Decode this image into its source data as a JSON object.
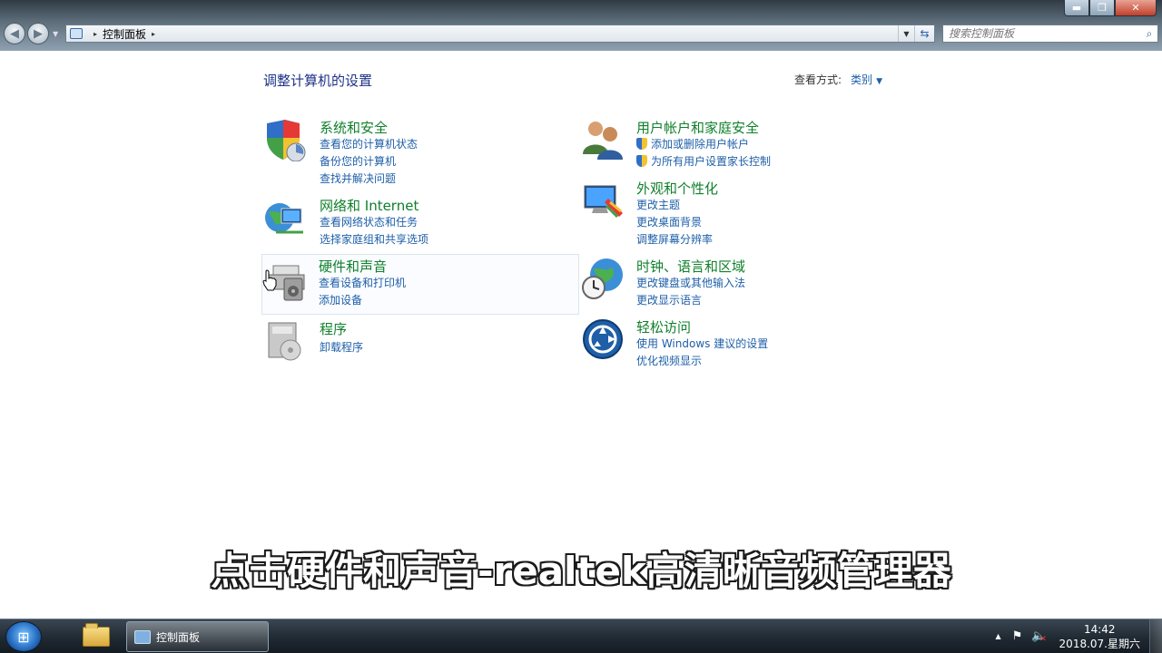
{
  "window": {
    "address": {
      "crumb": "控制面板",
      "crumb_sep": "▸"
    },
    "search": {
      "placeholder": "搜索控制面板"
    },
    "controls": {
      "min": "▬",
      "max": "❐",
      "close": "✕"
    }
  },
  "main": {
    "title": "调整计算机的设置",
    "view_by": {
      "label": "查看方式:",
      "value": "类别"
    },
    "categories": [
      {
        "name": "系统和安全",
        "icon": "shield-icon",
        "links": [
          "查看您的计算机状态",
          "备份您的计算机",
          "查找并解决问题"
        ]
      },
      {
        "name": "网络和 Internet",
        "icon": "network-globe-icon",
        "links": [
          "查看网络状态和任务",
          "选择家庭组和共享选项"
        ]
      },
      {
        "name": "硬件和声音",
        "icon": "printer-speaker-icon",
        "links": [
          "查看设备和打印机",
          "添加设备"
        ]
      },
      {
        "name": "程序",
        "icon": "programs-icon",
        "links": [
          "卸载程序"
        ]
      },
      {
        "name": "用户帐户和家庭安全",
        "icon": "users-icon",
        "links": [
          "添加或删除用户帐户",
          "为所有用户设置家长控制"
        ]
      },
      {
        "name": "外观和个性化",
        "icon": "monitor-paint-icon",
        "links": [
          "更改主题",
          "更改桌面背景",
          "调整屏幕分辨率"
        ]
      },
      {
        "name": "时钟、语言和区域",
        "icon": "clock-globe-icon",
        "links": [
          "更改键盘或其他输入法",
          "更改显示语言"
        ]
      },
      {
        "name": "轻松访问",
        "icon": "ease-of-access-icon",
        "links": [
          "使用 Windows 建议的设置",
          "优化视频显示"
        ]
      }
    ]
  },
  "subtitle": "点击硬件和声音-realtek高清晰音频管理器",
  "taskbar": {
    "app_label": "控制面板",
    "time": "14:42",
    "date": "2018.07.星期六"
  }
}
